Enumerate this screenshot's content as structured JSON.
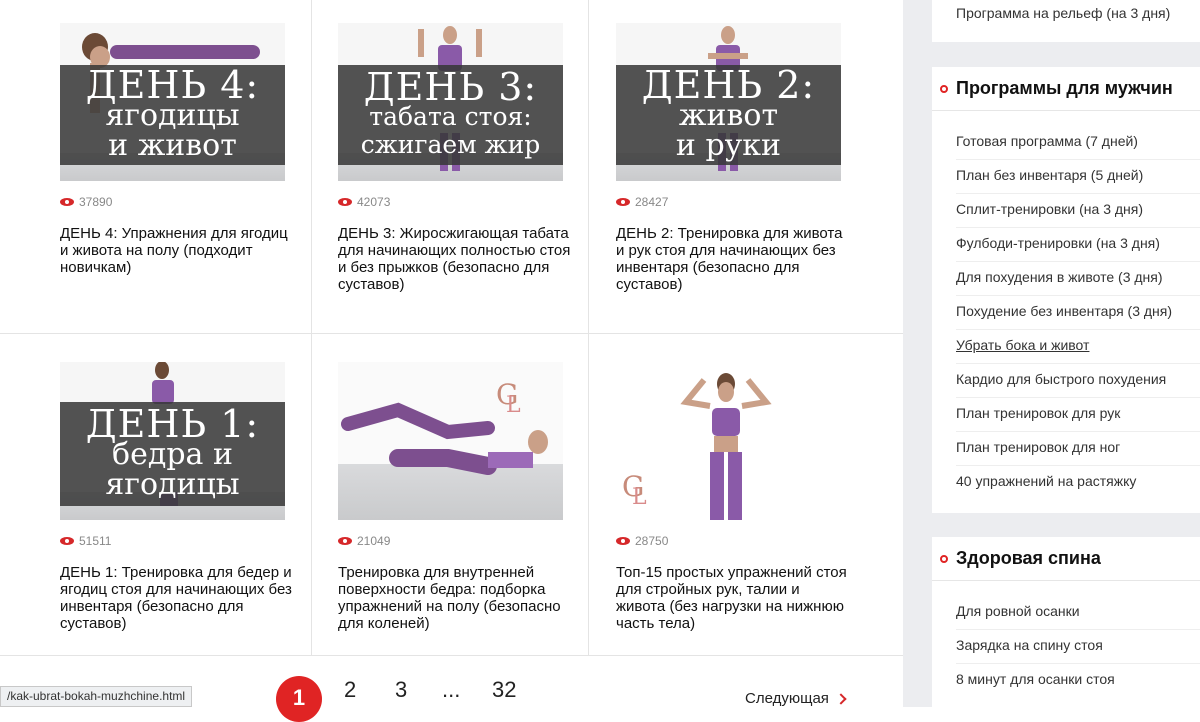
{
  "cards": [
    {
      "band": [
        "ДЕНЬ 4:",
        "ягодицы",
        "и живот"
      ],
      "views": "37890",
      "title": "ДЕНЬ 4: Упражнения для ягодиц и живота на полу (подходит новичкам)"
    },
    {
      "band": [
        "ДЕНЬ 3:",
        "табата стоя:",
        "сжигаем жир"
      ],
      "views": "42073",
      "title": "ДЕНЬ 3: Жиросжигающая табата для начинающих полностью стоя и без прыжков (безопасно для суставов)"
    },
    {
      "band": [
        "ДЕНЬ 2:",
        "живот",
        "и руки"
      ],
      "views": "28427",
      "title": "ДЕНЬ 2: Тренировка для живота и рук стоя для начинающих без инвентаря (безопасно для суставов)"
    },
    {
      "band": [
        "ДЕНЬ 1:",
        "бедра и",
        "ягодицы"
      ],
      "views": "51511",
      "title": "ДЕНЬ 1: Тренировка для бедер и ягодиц стоя для начинающих без инвентаря (безопасно для суставов)"
    },
    {
      "band": [],
      "logo": "GL",
      "views": "21049",
      "title": "Тренировка для внутренней поверхности бедра: подборка упражнений на полу (безопасно для коленей)"
    },
    {
      "band": [],
      "logo": "GL",
      "views": "28750",
      "title": "Топ-15 простых упражнений стоя для стройных рук, талии и живота (без нагрузки на нижнюю часть тела)"
    }
  ],
  "pagination": {
    "pages": [
      "1",
      "2",
      "3",
      "...",
      "32"
    ],
    "current": "1",
    "next_label": "Следующая"
  },
  "status_url": "/kak-ubrat-bokah-muzhchine.html",
  "sidebar": {
    "top_item": "Программа на рельеф (на 3 дня)",
    "men": {
      "heading": "Программы для мужчин",
      "items": [
        "Готовая программа (7 дней)",
        "План без инвентаря (5 дней)",
        "Сплит-тренировки (на 3 дня)",
        "Фулбоди-тренировки (на 3 дня)",
        "Для похудения в животе (3 дня)",
        "Похудение без инвентаря (3 дня)",
        "Убрать бока и живот",
        "Кардио для быстрого похудения",
        "План тренировок для рук",
        "План тренировок для ног",
        "40 упражнений на растяжку"
      ]
    },
    "back": {
      "heading": "Здоровая спина",
      "items": [
        "Для ровной осанки",
        "Зарядка на спину стоя",
        "8 минут для осанки стоя"
      ]
    }
  },
  "colors": {
    "accent": "#e02424",
    "sidebar_bg": "#ecedf0",
    "band_bg": "#373737",
    "outfit": "#8a5aa8"
  }
}
